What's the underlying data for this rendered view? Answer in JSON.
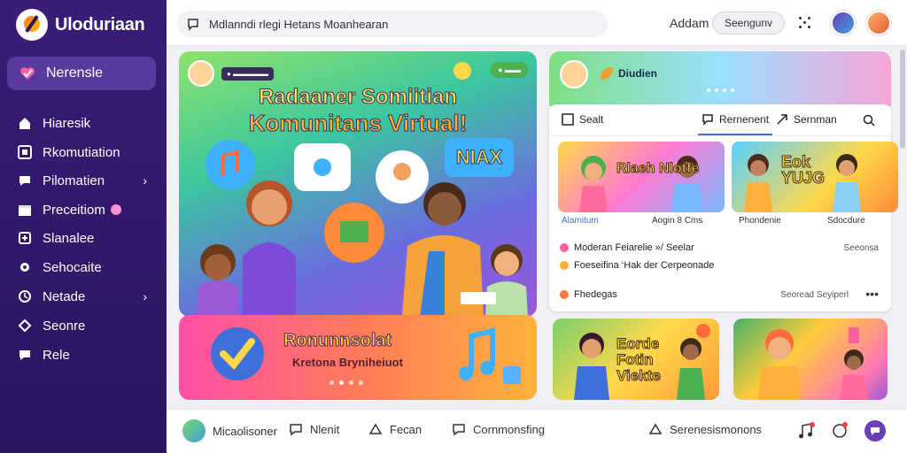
{
  "app": {
    "name": "Uloduriaan"
  },
  "sidebar": {
    "active": {
      "label": "Nerensle",
      "icon": "heart-check-icon"
    },
    "items": [
      {
        "label": "Hiaresik",
        "icon": "home-icon",
        "has_chevron": false
      },
      {
        "label": "Rkomutiation",
        "icon": "grid-icon",
        "has_chevron": false
      },
      {
        "label": "Pilomatien",
        "icon": "chat-icon",
        "has_chevron": true
      },
      {
        "label": "Preceitiom",
        "icon": "calendar-icon",
        "has_chevron": false
      },
      {
        "label": "Slanalee",
        "icon": "folder-icon",
        "has_chevron": false
      },
      {
        "label": "Sehocaite",
        "icon": "gear-icon",
        "has_chevron": false
      },
      {
        "label": "Netade",
        "icon": "clock-icon",
        "has_chevron": true
      },
      {
        "label": "Seonre",
        "icon": "star-icon",
        "has_chevron": false
      },
      {
        "label": "Rele",
        "icon": "help-icon",
        "has_chevron": false
      }
    ]
  },
  "topbar": {
    "search_text": "Mdlanndi  rlegi Hetans  Moanhearan",
    "user_name": "Addam",
    "pill_label": "Seengunv"
  },
  "hero": {
    "title_line1": "Radaaner Somiitian",
    "title_line2": "Komunitans Virtual!",
    "bubble_text": "NIAX"
  },
  "promo": {
    "title": "Ronunnsolat",
    "subtitle": "Kretona Bryniheiuot"
  },
  "banner": {
    "name": "Diudien"
  },
  "panel": {
    "tabs": [
      {
        "label": "Sealt",
        "icon": "square-icon"
      },
      {
        "label": "Rernenent",
        "icon": "comment-icon"
      },
      {
        "label": "Sernman",
        "icon": "share-icon"
      }
    ],
    "thumbs": [
      {
        "title": "Rlaeh Nlotfe",
        "label_left": "Alamitum",
        "label_right": "Aogin 8 Cms"
      },
      {
        "title": "Eok YUJG",
        "label_left": "Phondenie",
        "label_right": "Sdocdure"
      }
    ],
    "rows": [
      {
        "text": "Moderan Feiarelie  »/ Seelar",
        "right": "Seeonsa"
      },
      {
        "text": "Foeseifina ‘Hak  der Cerpeonade",
        "right": ""
      },
      {
        "text": "Fhedegas",
        "right": "Seoread Seyiperl"
      }
    ]
  },
  "cards": [
    {
      "text": "Eorde Fotin Viekte"
    },
    {
      "text": ""
    }
  ],
  "bottombar": {
    "user": "Micaolisoner",
    "items": [
      "Nlenit",
      "Fecan",
      "Cornmonsfing",
      "Serenesismonons"
    ]
  }
}
